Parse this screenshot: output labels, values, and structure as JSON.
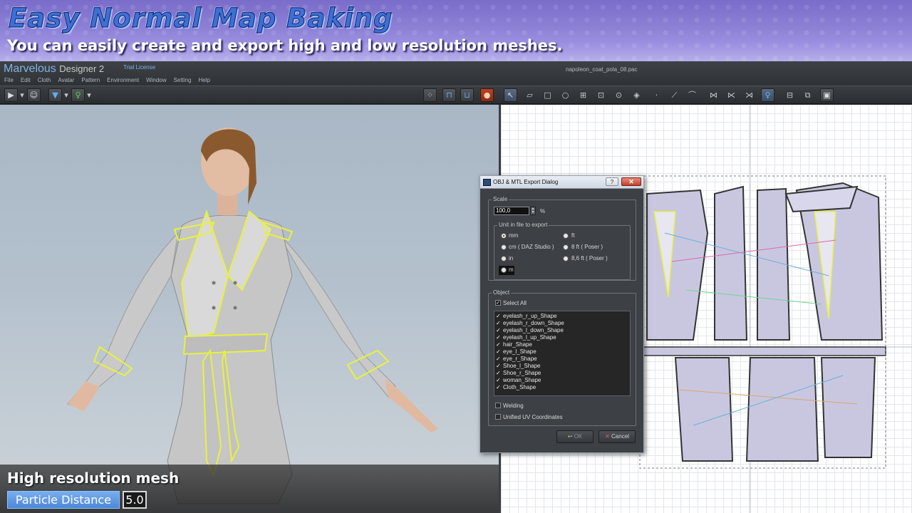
{
  "banner": {
    "title": "Easy Normal Map Baking",
    "subtitle": "You can easily create and export high and low resolution meshes."
  },
  "app": {
    "name": "Marvelous",
    "version": "Designer 2",
    "license": "Trial License",
    "file_name": "napoleon_coat_pola_08.pac"
  },
  "menu": [
    "File",
    "Edit",
    "Cloth",
    "Avatar",
    "Pattern",
    "Environment",
    "Window",
    "Setting",
    "Help"
  ],
  "toolbar_icons_3d": [
    "play-icon",
    "pose-icon",
    "shirt-icon",
    "avatar-icon",
    "scatter-icon",
    "coat-front-icon",
    "coat-back-icon",
    "record-icon"
  ],
  "toolbar_icons_2d": [
    "select-arrow-icon",
    "transform-pattern-icon",
    "rectangle-icon",
    "circle-icon",
    "internal-rect-icon",
    "internal-polygon-icon",
    "internal-circle-icon",
    "dart-icon",
    "point-icon",
    "edit-point-icon",
    "curve-icon",
    "sew-icon",
    "segment-sew-icon",
    "free-sew-icon",
    "avatar-view-icon",
    "grid-icon",
    "export-icon",
    "settings-icon"
  ],
  "viewport3d": {
    "overlay_label": "High resolution mesh",
    "param_label": "Particle Distance",
    "param_value": "5.0"
  },
  "dialog": {
    "title": "OBJ & MTL Export Dialog",
    "help_label": "?",
    "close_label": "✕",
    "scale_group": "Scale",
    "scale_value": "100,0",
    "scale_unit": "%",
    "unit_group": "Unit in file to export",
    "units": [
      {
        "label": "mm",
        "selected": true
      },
      {
        "label": "cm ( DAZ Studio )",
        "selected": false
      },
      {
        "label": "in",
        "selected": false
      },
      {
        "label": "m",
        "selected": false
      },
      {
        "label": "ft",
        "selected": false
      },
      {
        "label": "8 ft ( Poser )",
        "selected": false
      },
      {
        "label": "8,6 ft ( Poser )",
        "selected": false
      }
    ],
    "object_group": "Object",
    "select_all_label": "Select All",
    "objects": [
      "eyelash_r_up_Shape",
      "eyelash_r_down_Shape",
      "eyelash_l_down_Shape",
      "eyelash_l_up_Shape",
      "hair_Shape",
      "eye_l_Shape",
      "eye_r_Shape",
      "Shoe_l_Shape",
      "Shoe_r_Shape",
      "woman_Shape",
      "Cloth_Shape"
    ],
    "welding_label": "Welding",
    "unified_uv_label": "Unified UV Coordinates",
    "ok_label": "OK",
    "cancel_label": "Cancel"
  },
  "colors": {
    "accent": "#7eb3e8",
    "selection_outline": "#e8f23a",
    "particle_label_bg": "#5a96e2"
  }
}
